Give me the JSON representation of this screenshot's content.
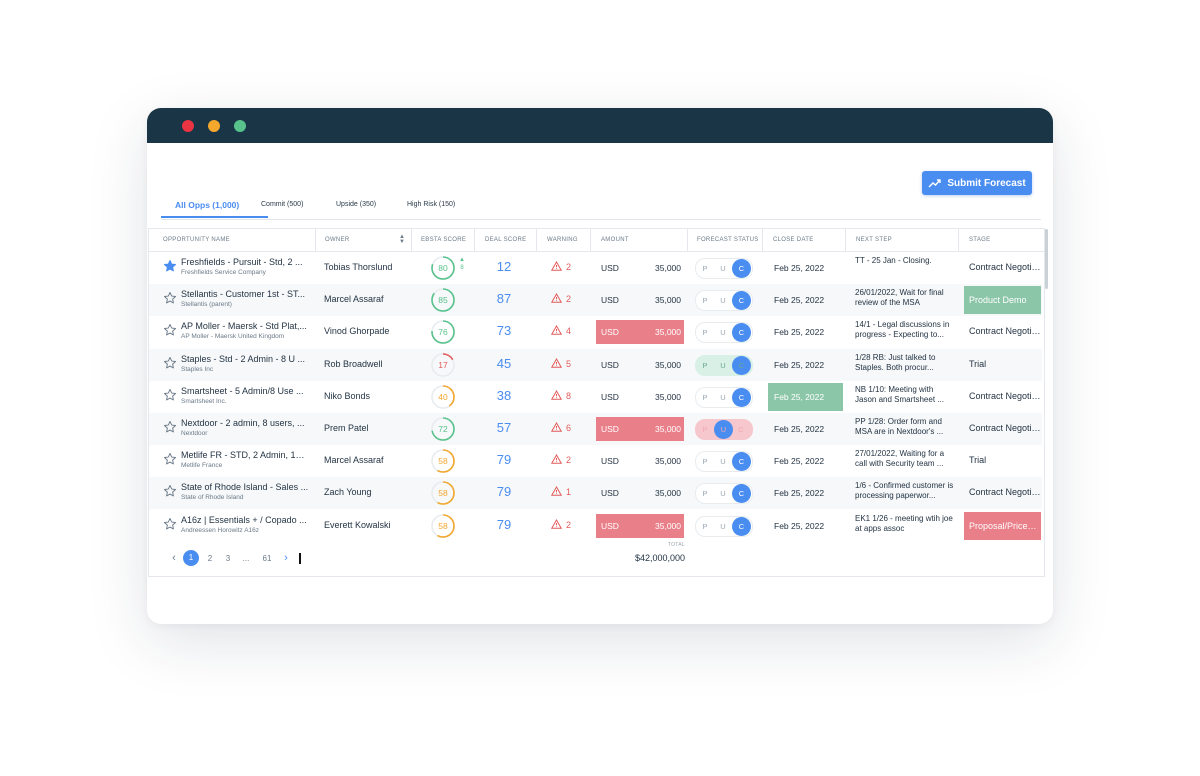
{
  "toolbar": {
    "submit_label": "Submit Forecast"
  },
  "tabs": [
    {
      "label": "All Opps (1,000)"
    },
    {
      "label": "Commit (500)"
    },
    {
      "label": "Upside (350)"
    },
    {
      "label": "High Risk (150)"
    }
  ],
  "columns": [
    "OPPORTUNITY NAME",
    "OWNER",
    "EBSTA SCORE",
    "DEAL SCORE",
    "WARNING",
    "AMOUNT",
    "FORECAST STATUS",
    "CLOSE DATE",
    "NEXT STEP",
    "STAGE"
  ],
  "forecast_options": [
    "P",
    "U",
    "C"
  ],
  "colors": {
    "accent": "#4a8df0",
    "score_green": "#57c28b",
    "score_red": "#e45b5b",
    "score_orange": "#f3a72c",
    "highlight_red": "#e97f89",
    "highlight_green": "#8cc6a8"
  },
  "rows": [
    {
      "starred": true,
      "name": "Freshfields - Pursuit - Std, 2 ...",
      "sub": "Freshfields Service Company",
      "owner": "Tobias Thorslund",
      "score": "80",
      "score_level": 0.8,
      "score_color": "green",
      "trend_arrow": "▲",
      "trend_value": "8",
      "deal": "12",
      "warn": "2",
      "amount_cur": "USD",
      "amount_val": "35,000",
      "amount_highlight": false,
      "fc": "C",
      "fc_bg": "none",
      "close": "Feb 25, 2022",
      "close_highlight": false,
      "next": "TT - 25 Jan - Closing.",
      "stage": "Contract Negotia...",
      "stage_highlight": "none"
    },
    {
      "starred": false,
      "name": "Stellantis - Customer 1st - ST...",
      "sub": "Stellantis (parent)",
      "owner": "Marcel Assaraf",
      "score": "85",
      "score_level": 0.85,
      "score_color": "green",
      "deal": "87",
      "warn": "2",
      "amount_cur": "USD",
      "amount_val": "35,000",
      "amount_highlight": false,
      "fc": "C",
      "fc_bg": "none",
      "close": "Feb 25, 2022",
      "close_highlight": false,
      "next": "26/01/2022, Wait for final review of the MSA",
      "stage": "Product Demo",
      "stage_highlight": "green"
    },
    {
      "starred": false,
      "name": "AP Moller - Maersk - Std Plat,...",
      "sub": "AP Moller - Maersk United Kingdom",
      "owner": "Vinod Ghorpade",
      "score": "76",
      "score_level": 0.76,
      "score_color": "green",
      "deal": "73",
      "warn": "4",
      "amount_cur": "USD",
      "amount_val": "35,000",
      "amount_highlight": true,
      "fc": "C",
      "fc_bg": "none",
      "close": "Feb 25, 2022",
      "close_highlight": false,
      "next": "14/1 - Legal discussions in progress - Expecting to...",
      "stage": "Contract Negotia...",
      "stage_highlight": "none"
    },
    {
      "starred": false,
      "name": "Staples - Std - 2 Admin - 8 U ...",
      "sub": "Staples Inc",
      "owner": "Rob Broadwell",
      "score": "17",
      "score_level": 0.17,
      "score_color": "red",
      "deal": "45",
      "warn": "5",
      "amount_cur": "USD",
      "amount_val": "35,000",
      "amount_highlight": false,
      "fc": "C",
      "fc_bg": "green",
      "close": "Feb 25, 2022",
      "close_highlight": false,
      "next": "1/28 RB: Just talked to Staples. Both procur...",
      "stage": "Trial",
      "stage_highlight": "none"
    },
    {
      "starred": false,
      "name": "Smartsheet - 5 Admin/8 Use ...",
      "sub": "Smartsheet Inc.",
      "owner": "Niko Bonds",
      "score": "40",
      "score_level": 0.4,
      "score_color": "orange",
      "deal": "38",
      "warn": "8",
      "amount_cur": "USD",
      "amount_val": "35,000",
      "amount_highlight": false,
      "fc": "C",
      "fc_bg": "none",
      "close": "Feb 25, 2022",
      "close_highlight": true,
      "next": "NB 1/10: Meeting with Jason and Smartsheet ...",
      "stage": "Contract Negotia...",
      "stage_highlight": "none"
    },
    {
      "starred": false,
      "name": "Nextdoor - 2 admin, 8 users, ...",
      "sub": "Nextdoor",
      "owner": "Prem Patel",
      "score": "72",
      "score_level": 0.72,
      "score_color": "green",
      "deal": "57",
      "warn": "6",
      "amount_cur": "USD",
      "amount_val": "35,000",
      "amount_highlight": true,
      "fc": "U",
      "fc_bg": "red",
      "close": "Feb 25, 2022",
      "close_highlight": false,
      "next": "PP 1/28: Order form and MSA are in Nextdoor's ...",
      "stage": "Contract Negotia...",
      "stage_highlight": "none"
    },
    {
      "starred": false,
      "name": "Metlife FR - STD, 2 Admin, 18 ...",
      "sub": "Metlife France",
      "owner": "Marcel Assaraf",
      "score": "58",
      "score_level": 0.58,
      "score_color": "orange",
      "deal": "79",
      "warn": "2",
      "amount_cur": "USD",
      "amount_val": "35,000",
      "amount_highlight": false,
      "fc": "C",
      "fc_bg": "none",
      "close": "Feb 25, 2022",
      "close_highlight": false,
      "next": "27/01/2022, Waiting for a call with Security team ...",
      "stage": "Trial",
      "stage_highlight": "none"
    },
    {
      "starred": false,
      "name": "State of Rhode Island - Sales ...",
      "sub": "State of Rhode Island",
      "owner": "Zach Young",
      "score": "58",
      "score_level": 0.58,
      "score_color": "orange",
      "deal": "79",
      "warn": "1",
      "amount_cur": "USD",
      "amount_val": "35,000",
      "amount_highlight": false,
      "fc": "C",
      "fc_bg": "none",
      "close": "Feb 25, 2022",
      "close_highlight": false,
      "next": "1/6 - Confirmed customer is processing paperwor...",
      "stage": "Contract Negotia...",
      "stage_highlight": "none"
    },
    {
      "starred": false,
      "name": "A16z | Essentials + / Copado ...",
      "sub": "Andreessen Horowitz A16z",
      "owner": "Everett Kowalski",
      "score": "58",
      "score_level": 0.58,
      "score_color": "orange",
      "deal": "79",
      "warn": "2",
      "amount_cur": "USD",
      "amount_val": "35,000",
      "amount_highlight": true,
      "fc": "C",
      "fc_bg": "none",
      "close": "Feb 25, 2022",
      "close_highlight": false,
      "next": "EK1 1/26 - meeting wtih joe at apps assoc",
      "stage": "Proposal/Price Q...",
      "stage_highlight": "red"
    }
  ],
  "pagination": {
    "prev": "‹",
    "pages": [
      "1",
      "2",
      "3",
      "...",
      "61"
    ],
    "next": "›"
  },
  "total": {
    "label": "TOTAL",
    "value": "$42,000,000"
  }
}
